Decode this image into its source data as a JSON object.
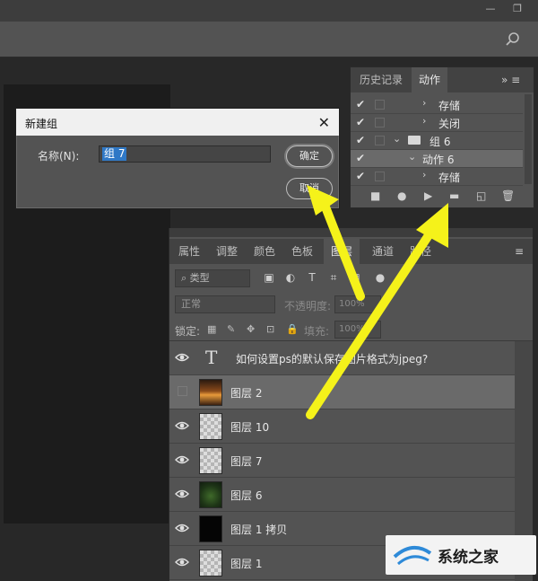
{
  "window": {
    "minimize_label": "—",
    "restore_label": "❐"
  },
  "dialog": {
    "title": "新建组",
    "close_label": "✕",
    "name_label": "名称(N):",
    "name_value": "组 7",
    "ok_label": "确定",
    "cancel_label": "取消"
  },
  "actions_panel": {
    "tabs": [
      "历史记录",
      "动作"
    ],
    "menu": "»  ≡",
    "rows": [
      {
        "label": "存储",
        "checked": true
      },
      {
        "label": "关闭",
        "checked": true
      },
      {
        "label": "组 6",
        "checked": true
      },
      {
        "label": "动作 6",
        "checked": true
      },
      {
        "label": "存储",
        "checked": true
      }
    ],
    "footer_icons": [
      "stop-icon",
      "record-icon",
      "play-icon",
      "folder-icon",
      "new-action-icon",
      "delete-icon"
    ]
  },
  "layers_panel": {
    "tabs": [
      "属性",
      "调整",
      "颜色",
      "色板",
      "图层",
      "通道",
      "路径"
    ],
    "filter_kind": "类型",
    "blend_mode": "正常",
    "opacity_label": "不透明度:",
    "opacity_value": "100%",
    "lock_label": "锁定:",
    "fill_label": "填充:",
    "fill_value": "100%",
    "layers": [
      {
        "name": "如何设置ps的默认保存图片格式为jpeg?",
        "type": "text"
      },
      {
        "name": "图层 2",
        "type": "image"
      },
      {
        "name": "图层 10",
        "type": "image"
      },
      {
        "name": "图层 7",
        "type": "image"
      },
      {
        "name": "图层 6",
        "type": "image"
      },
      {
        "name": "图层 1 拷贝",
        "type": "image"
      },
      {
        "name": "图层 1",
        "type": "image"
      }
    ]
  },
  "watermark": {
    "text": "系统之家"
  },
  "colors": {
    "arrow": "#f5f21a",
    "selection": "#2f78c6"
  }
}
